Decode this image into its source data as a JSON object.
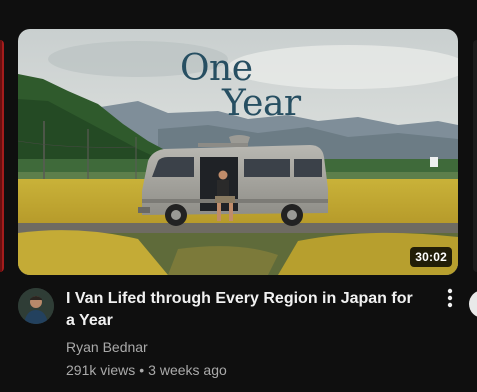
{
  "thumbnail": {
    "overlay_title_line1": "One",
    "overlay_title_line2": "Year",
    "duration": "30:02"
  },
  "video": {
    "title": "I Van Lifed through Every Region in Japan for a Year",
    "channel": "Ryan Bednar",
    "views": "291k views",
    "separator": "•",
    "age": "3 weeks ago"
  },
  "icons": {
    "menu": "more-vert-icon",
    "avatar": "channel-avatar"
  },
  "colors": {
    "background": "#0f0f0f",
    "title_text": "#f1f1f1",
    "secondary_text": "#aaaaaa",
    "overlay_title": "#274f62"
  }
}
